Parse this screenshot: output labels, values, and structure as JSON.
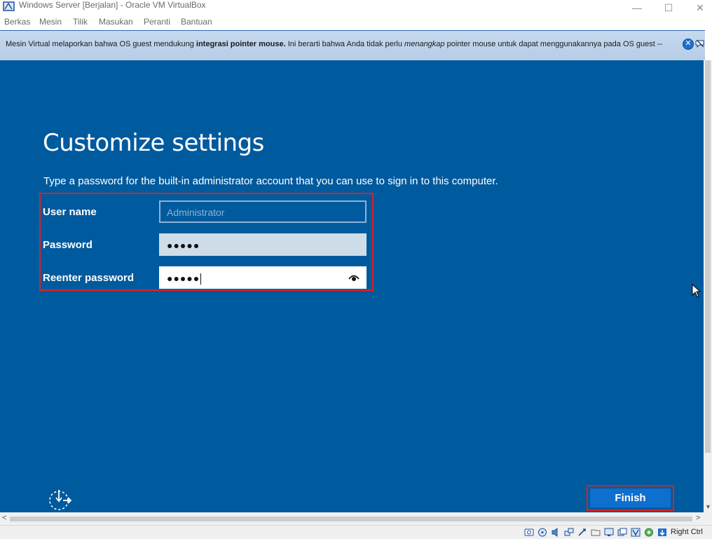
{
  "window": {
    "title": "Windows Server [Berjalan] - Oracle VM VirtualBox",
    "minimize": "—",
    "maximize": "☐",
    "close": "✕"
  },
  "menu": [
    "Berkas",
    "Mesin",
    "Tilik",
    "Masukan",
    "Peranti",
    "Bantuan"
  ],
  "notification": {
    "part1": "Mesin Virtual melaporkan bahwa OS guest mendukung ",
    "bold": "integrasi pointer mouse.",
    "part2": " Ini berarti bahwa Anda tidak perlu ",
    "italic": "menangkap",
    "part3": " pointer mouse untuk dapat menggunakannya pada OS guest --",
    "close_glyph": "✕"
  },
  "setup": {
    "heading": "Customize settings",
    "instruction": "Type a password for the built-in administrator account that you can use to sign in to this computer.",
    "fields": {
      "username_label": "User name",
      "username_placeholder": "Administrator",
      "password_label": "Password",
      "password_value": "●●●●●",
      "reenter_label": "Reenter password",
      "reenter_value": "●●●●●"
    },
    "finish_label": "Finish"
  },
  "scroll": {
    "left": "<",
    "right": ">",
    "down": "▼"
  },
  "statusbar": {
    "host_key": "Right Ctrl"
  },
  "colors": {
    "guest_bg": "#005a9e",
    "highlight": "#e0201e",
    "finish_bg": "#0f6fcf"
  },
  "icons": [
    "virtualbox-icon",
    "close-notification-icon",
    "mute-notification-icon",
    "ease-of-access-icon",
    "reveal-password-icon",
    "mouse-pointer-icon"
  ]
}
